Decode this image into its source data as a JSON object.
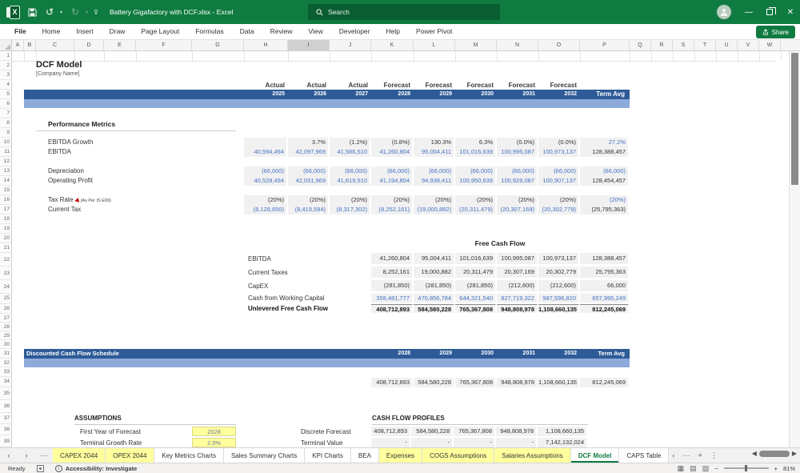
{
  "titlebar": {
    "title": "Battery Gigafactory with DCF.xlsx  -  Excel",
    "search_placeholder": "Search",
    "share_label": "Share"
  },
  "ribbon_tabs": [
    "File",
    "Home",
    "Insert",
    "Draw",
    "Page Layout",
    "Formulas",
    "Data",
    "Review",
    "View",
    "Developer",
    "Help",
    "Power Pivot"
  ],
  "column_headers": [
    "A",
    "B",
    "C",
    "D",
    "E",
    "F",
    "G",
    "H",
    "I",
    "J",
    "K",
    "L",
    "M",
    "N",
    "O",
    "P",
    "Q",
    "R",
    "S",
    "T",
    "U",
    "V",
    "W"
  ],
  "selected_column": "I",
  "row_count": 39,
  "doc": {
    "title": "DCF Model",
    "subtitle": "[Company Name]",
    "period_types": [
      "Actual",
      "Actual",
      "Actual",
      "Forecast",
      "Forecast",
      "Forecast",
      "Forecast",
      "Forecast"
    ],
    "years": [
      "2025",
      "2026",
      "2027",
      "2028",
      "2029",
      "2030",
      "2031",
      "2032"
    ],
    "term_label": "Term Avg",
    "performance": {
      "header": "Performance Metrics",
      "rows": [
        {
          "id": 10,
          "label": "EBITDA Growth",
          "values": [
            "",
            "3.7%",
            "(1.2%)",
            "(0.8%)",
            "130.3%",
            "6.3%",
            "(0.0%)",
            "(0.0%)"
          ],
          "values_cls": "dark",
          "term": "27.2%",
          "term_cls": "blue"
        },
        {
          "id": 11,
          "label": "EBITDA",
          "values": [
            "40,594,494",
            "42,097,969",
            "41,586,510",
            "41,260,804",
            "95,004,411",
            "101,016,639",
            "100,995,087",
            "100,973,137"
          ],
          "values_cls": "blue",
          "term": "128,388,457",
          "term_cls": "dark"
        },
        {
          "id": 13,
          "label": "Depreciation",
          "values": [
            "(66,000)",
            "(66,000)",
            "(66,000)",
            "(66,000)",
            "(66,000)",
            "(66,000)",
            "(66,000)",
            "(66,000)"
          ],
          "values_cls": "blue",
          "term": "(66,000)",
          "term_cls": "blue"
        },
        {
          "id": 14,
          "label": "Operating Profit",
          "values": [
            "40,528,494",
            "42,031,969",
            "41,619,510",
            "41,194,804",
            "94,938,411",
            "100,950,639",
            "100,929,087",
            "100,907,137"
          ],
          "values_cls": "blue",
          "term": "128,454,457",
          "term_cls": "dark"
        },
        {
          "id": 16,
          "label": "Tax Rate",
          "note": "(As Per IS E69)",
          "values": [
            "(20%)",
            "(20%)",
            "(20%)",
            "(20%)",
            "(20%)",
            "(20%)",
            "(20%)",
            "(20%)"
          ],
          "values_cls": "dark",
          "term": "(20%)",
          "term_cls": "blue"
        },
        {
          "id": 17,
          "label": "Current Tax",
          "values": [
            "(8,128,650)",
            "(8,419,594)",
            "(8,317,302)",
            "(8,252,161)",
            "(19,000,882)",
            "(20,311,479)",
            "(20,307,169)",
            "(20,302,779)"
          ],
          "values_cls": "blue",
          "term": "(25,795,363)",
          "term_cls": "dark"
        }
      ]
    },
    "fcf": {
      "title": "Free Cash Flow",
      "rows": [
        {
          "label": "EBITDA",
          "values": [
            "41,260,804",
            "95,004,411",
            "101,016,639",
            "100,995,087",
            "100,973,137",
            "128,388,457"
          ],
          "cls": "dark"
        },
        {
          "label": "Current Taxes",
          "values": [
            "8,252,161",
            "19,000,882",
            "20,311,479",
            "20,307,169",
            "20,302,779",
            "25,795,363"
          ],
          "cls": "dark"
        },
        {
          "label": "CapEX",
          "values": [
            "(281,850)",
            "(281,850)",
            "(281,850)",
            "(212,600)",
            "(212,600)",
            "66,000"
          ],
          "cls": "dark"
        },
        {
          "label": "Cash from Working Capital",
          "values": [
            "359,481,777",
            "470,856,784",
            "644,321,540",
            "827,719,322",
            "987,596,820",
            "657,995,249"
          ],
          "cls": "blue"
        },
        {
          "label": "Unlevered Free Cash Flow",
          "values": [
            "408,712,893",
            "584,580,228",
            "765,367,808",
            "948,808,978",
            "1,108,660,135",
            "812,245,069"
          ],
          "cls": "dark bold",
          "topline": true
        }
      ]
    },
    "dcf_schedule": {
      "header": "Discounted Cash Flow Schedule",
      "years": [
        "2028",
        "2029",
        "2030",
        "2031",
        "2032"
      ],
      "term_label": "Term Avg",
      "values": [
        "408,712,893",
        "584,580,228",
        "765,367,808",
        "948,808,978",
        "1,108,660,135",
        "812,245,069"
      ]
    },
    "assumptions": {
      "header": "ASSUMPTIONS",
      "rows": [
        {
          "label": "First Year of Forecast",
          "value": "2028"
        },
        {
          "label": "Terminal Growth Rate",
          "value": "2.0%"
        }
      ]
    },
    "cash_flow_profiles": {
      "header": "CASH FLOW PROFILES",
      "rows": [
        {
          "label": "Discrete Forecast",
          "values": [
            "408,712,893",
            "584,580,228",
            "765,367,808",
            "948,808,978",
            "1,108,660,135"
          ]
        },
        {
          "label": "Terminal Value",
          "values": [
            "-",
            "-",
            "-",
            "-",
            "7,142,132,024"
          ]
        }
      ]
    }
  },
  "sheet_tabs": [
    {
      "label": "CAPEX 2044",
      "highlight": true
    },
    {
      "label": "OPEX 2044",
      "highlight": true
    },
    {
      "label": "Key Metrics Charts"
    },
    {
      "label": "Sales Summary Charts"
    },
    {
      "label": "KPI Charts"
    },
    {
      "label": "BEA"
    },
    {
      "label": "Expenses",
      "highlight": true
    },
    {
      "label": "COGS Assumptions",
      "highlight": true
    },
    {
      "label": "Salaries Assumptions",
      "highlight": true
    },
    {
      "label": "DCF Model",
      "active": true
    },
    {
      "label": "CAPS Table"
    }
  ],
  "status_bar": {
    "ready": "Ready",
    "accessibility": "Accessibility: Investigate",
    "zoom": "81%"
  },
  "colors": {
    "band_dark": "#2e5b97",
    "band_light": "#8eaadb",
    "value_blue": "#4472c4",
    "excel_green": "#0f7b40",
    "input_yellow": "#ffff9e",
    "tab_yellow": "#ffff9e"
  }
}
